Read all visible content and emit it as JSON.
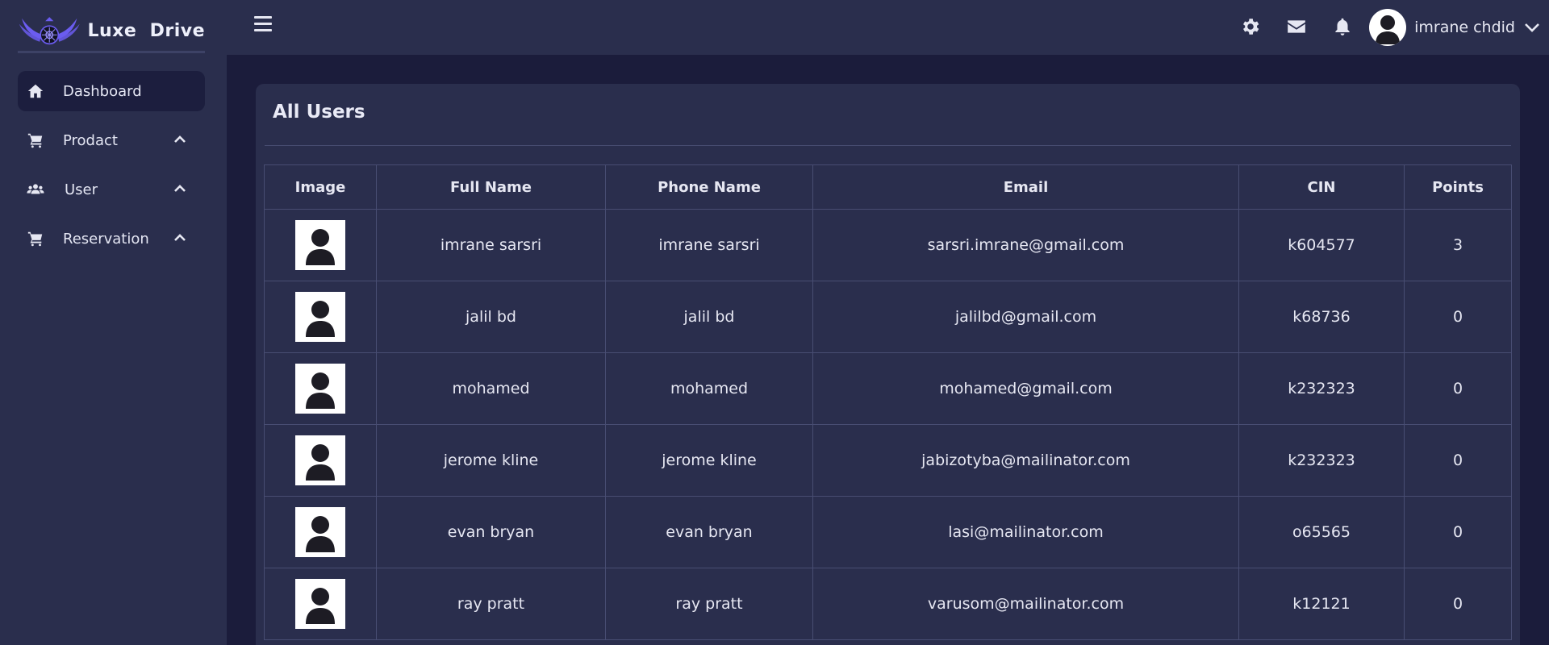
{
  "app": {
    "brand": "Luxe  Drive",
    "logo_icon": "winged-wheel-logo"
  },
  "sidebar": {
    "items": [
      {
        "label": "Dashboard",
        "icon": "home-icon",
        "active": true,
        "expandable": false
      },
      {
        "label": "Prodact",
        "icon": "cart-icon",
        "active": false,
        "expandable": true
      },
      {
        "label": "User",
        "icon": "users-icon",
        "active": false,
        "expandable": true
      },
      {
        "label": "Reservation",
        "icon": "cart-icon",
        "active": false,
        "expandable": true
      }
    ]
  },
  "topbar": {
    "menu_icon": "hamburger-icon",
    "icons": [
      "gear-icon",
      "mail-icon",
      "bell-icon"
    ],
    "user": {
      "name": "imrane chdid",
      "avatar": "user-avatar-icon",
      "dropdown_icon": "chevron-down-icon"
    }
  },
  "main": {
    "title": "All Users",
    "table": {
      "headers": [
        "Image",
        "Full Name",
        "Phone Name",
        "Email",
        "CIN",
        "Points"
      ],
      "rows": [
        {
          "full_name": "imrane sarsri",
          "phone_name": "imrane sarsri",
          "email": "sarsri.imrane@gmail.com",
          "cin": "k604577",
          "points": "3"
        },
        {
          "full_name": "jalil bd",
          "phone_name": "jalil bd",
          "email": "jalilbd@gmail.com",
          "cin": "k68736",
          "points": "0"
        },
        {
          "full_name": "mohamed",
          "phone_name": "mohamed",
          "email": "mohamed@gmail.com",
          "cin": "k232323",
          "points": "0"
        },
        {
          "full_name": "jerome kline",
          "phone_name": "jerome kline",
          "email": "jabizotyba@mailinator.com",
          "cin": "k232323",
          "points": "0"
        },
        {
          "full_name": "evan bryan",
          "phone_name": "evan bryan",
          "email": "lasi@mailinator.com",
          "cin": "o65565",
          "points": "0"
        },
        {
          "full_name": "ray pratt",
          "phone_name": "ray pratt",
          "email": "varusom@mailinator.com",
          "cin": "k12121",
          "points": "0"
        }
      ]
    }
  },
  "colors": {
    "page_bg": "#1b1c3b",
    "panel_bg": "#2a2e4d",
    "active_nav_bg": "#1c1e3e",
    "text": "#e6e7f2",
    "border": "#484d72",
    "logo_accent": "#6b5cf0"
  }
}
